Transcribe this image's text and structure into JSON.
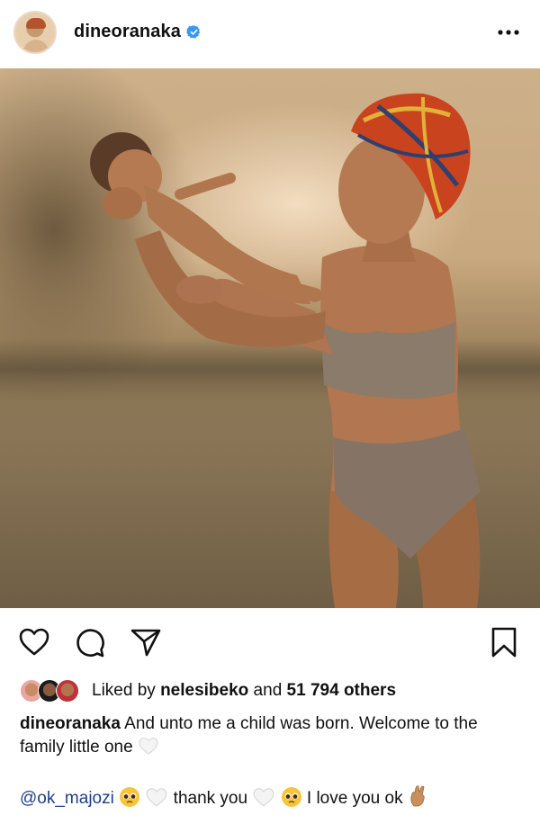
{
  "post": {
    "username": "dineoranaka",
    "verified": true,
    "more_icon": "ellipsis-icon",
    "photo_alt": "Woman in headwrap lifting newborn baby outdoors"
  },
  "actions": {
    "icons": [
      "heart-icon",
      "comment-icon",
      "share-icon",
      "bookmark-icon"
    ]
  },
  "likes": {
    "prefix": "Liked by ",
    "liked_by_user": "nelesibeko",
    "connector": " and ",
    "others": "51 794 others"
  },
  "caption": {
    "username": "dineoranaka",
    "text": " And unto me a child was born. Welcome to the family little one "
  },
  "comment": {
    "mention": "@ok_majozi",
    "part1": " thank you ",
    "part2": " I love you ok "
  },
  "colors": {
    "verified_blue": "#3897f0",
    "mention_blue": "#1e3f8a",
    "text": "#111111"
  }
}
